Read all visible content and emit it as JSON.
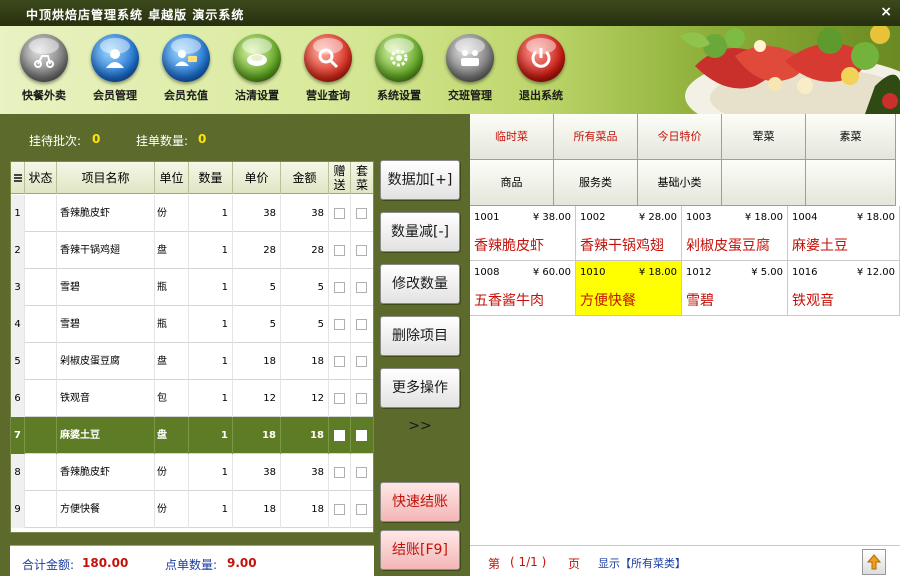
{
  "window": {
    "title": "中顶烘焙店管理系统 卓越版 演示系统",
    "close_glyph": "×"
  },
  "toolbar": [
    {
      "label": "快餐外卖",
      "icon": "scooter-icon",
      "color": "gray"
    },
    {
      "label": "会员管理",
      "icon": "member-icon",
      "color": "blue"
    },
    {
      "label": "会员充值",
      "icon": "recharge-icon",
      "color": "blue"
    },
    {
      "label": "沽清设置",
      "icon": "plate-icon",
      "color": "green"
    },
    {
      "label": "营业查询",
      "icon": "search-icon",
      "color": "red"
    },
    {
      "label": "系统设置",
      "icon": "gear-icon",
      "color": "green"
    },
    {
      "label": "交班管理",
      "icon": "handover-icon",
      "color": "gray"
    },
    {
      "label": "退出系统",
      "icon": "power-icon",
      "color": "darkred"
    }
  ],
  "info": {
    "waiting_label": "挂待批次:",
    "waiting_value": "0",
    "held_label": "挂单数量:",
    "held_value": "0"
  },
  "order_grid": {
    "columns": [
      "状态",
      "项目名称",
      "单位",
      "数量",
      "单价",
      "金额",
      "赠送",
      "套菜"
    ],
    "rows": [
      {
        "no": "1",
        "status": "",
        "name": "香辣脆皮虾",
        "unit": "份",
        "qty": "1",
        "price": "38",
        "amount": "38"
      },
      {
        "no": "2",
        "status": "",
        "name": "香辣干锅鸡翅",
        "unit": "盘",
        "qty": "1",
        "price": "28",
        "amount": "28"
      },
      {
        "no": "3",
        "status": "",
        "name": "雪碧",
        "unit": "瓶",
        "qty": "1",
        "price": "5",
        "amount": "5"
      },
      {
        "no": "4",
        "status": "",
        "name": "雪碧",
        "unit": "瓶",
        "qty": "1",
        "price": "5",
        "amount": "5"
      },
      {
        "no": "5",
        "status": "",
        "name": "剁椒皮蛋豆腐",
        "unit": "盘",
        "qty": "1",
        "price": "18",
        "amount": "18"
      },
      {
        "no": "6",
        "status": "",
        "name": "铁观音",
        "unit": "包",
        "qty": "1",
        "price": "12",
        "amount": "12"
      },
      {
        "no": "7",
        "status": "",
        "name": "麻婆土豆",
        "unit": "盘",
        "qty": "1",
        "price": "18",
        "amount": "18",
        "selected": true
      },
      {
        "no": "8",
        "status": "",
        "name": "香辣脆皮虾",
        "unit": "份",
        "qty": "1",
        "price": "38",
        "amount": "38"
      },
      {
        "no": "9",
        "status": "",
        "name": "方便快餐",
        "unit": "份",
        "qty": "1",
        "price": "18",
        "amount": "18"
      }
    ]
  },
  "totals": {
    "total_label": "合计金额:",
    "total_value": "180.00",
    "count_label": "点单数量:",
    "count_value": "9.00"
  },
  "actions": {
    "add_qty": "数据加[+]",
    "sub_qty": "数量减[-]",
    "edit_qty": "修改数量",
    "delete_item": "删除项目",
    "more_ops": "更多操作>>",
    "quick_checkout": "快速结账",
    "checkout": "结账[F9]"
  },
  "categories": [
    {
      "label": "临时菜",
      "hot": true
    },
    {
      "label": "所有菜品",
      "hot": true
    },
    {
      "label": "今日特价",
      "hot": true
    },
    {
      "label": "荤菜",
      "hot": false
    },
    {
      "label": "素菜",
      "hot": false
    },
    {
      "label": "商品",
      "hot": false
    },
    {
      "label": "服务类",
      "hot": false
    },
    {
      "label": "基础小类",
      "hot": false
    },
    {
      "label": "",
      "hot": false
    },
    {
      "label": "",
      "hot": false
    }
  ],
  "menu_items": [
    {
      "code": "1001",
      "price": "¥ 38.00",
      "name": "香辣脆皮虾"
    },
    {
      "code": "1002",
      "price": "¥ 28.00",
      "name": "香辣干锅鸡翅"
    },
    {
      "code": "1003",
      "price": "¥ 18.00",
      "name": "剁椒皮蛋豆腐"
    },
    {
      "code": "1004",
      "price": "¥ 18.00",
      "name": "麻婆土豆"
    },
    {
      "code": "1008",
      "price": "¥ 60.00",
      "name": "五香酱牛肉"
    },
    {
      "code": "1010",
      "price": "¥ 18.00",
      "name": "方便快餐",
      "highlight": true
    },
    {
      "code": "1012",
      "price": "¥ 5.00",
      "name": "雪碧"
    },
    {
      "code": "1016",
      "price": "¥ 12.00",
      "name": "铁观音"
    }
  ],
  "pager": {
    "page_prefix": "第",
    "page_value": "( 1/1 )",
    "page_suffix": "页",
    "show_label": "显示【所有菜类】"
  }
}
